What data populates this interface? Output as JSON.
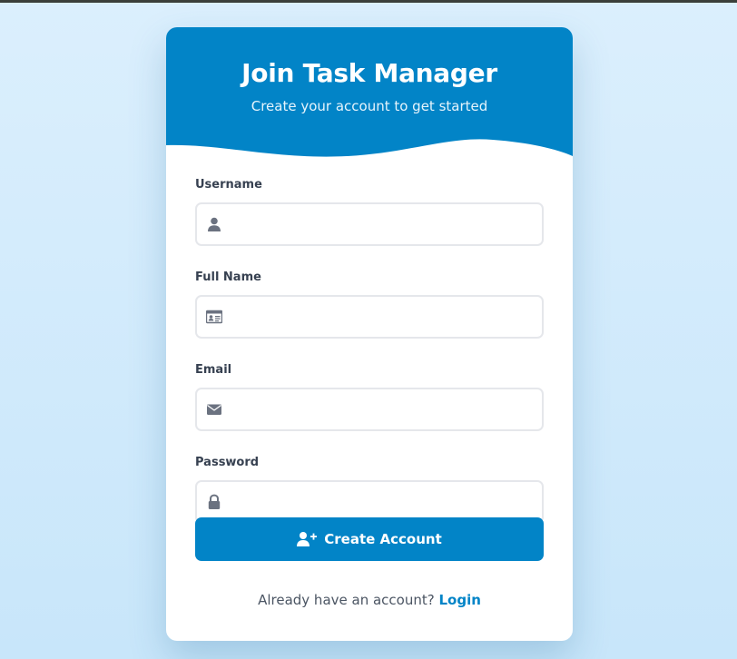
{
  "header": {
    "title": "Join Task Manager",
    "subtitle": "Create your account to get started"
  },
  "fields": [
    {
      "label": "Username",
      "icon": "user-icon",
      "value": "",
      "type": "text"
    },
    {
      "label": "Full Name",
      "icon": "id-card-icon",
      "value": "",
      "type": "text"
    },
    {
      "label": "Email",
      "icon": "envelope-icon",
      "value": "",
      "type": "email"
    },
    {
      "label": "Password",
      "icon": "lock-icon",
      "value": "",
      "type": "password"
    }
  ],
  "submit": {
    "label": "Create Account",
    "icon": "user-plus-icon"
  },
  "footer": {
    "prompt": "Already have an account?",
    "link_label": "Login"
  },
  "colors": {
    "primary": "#0284c7",
    "background": "#dbeffd",
    "card": "#ffffff",
    "icon_gray": "#6b7280",
    "label_text": "#374151"
  }
}
